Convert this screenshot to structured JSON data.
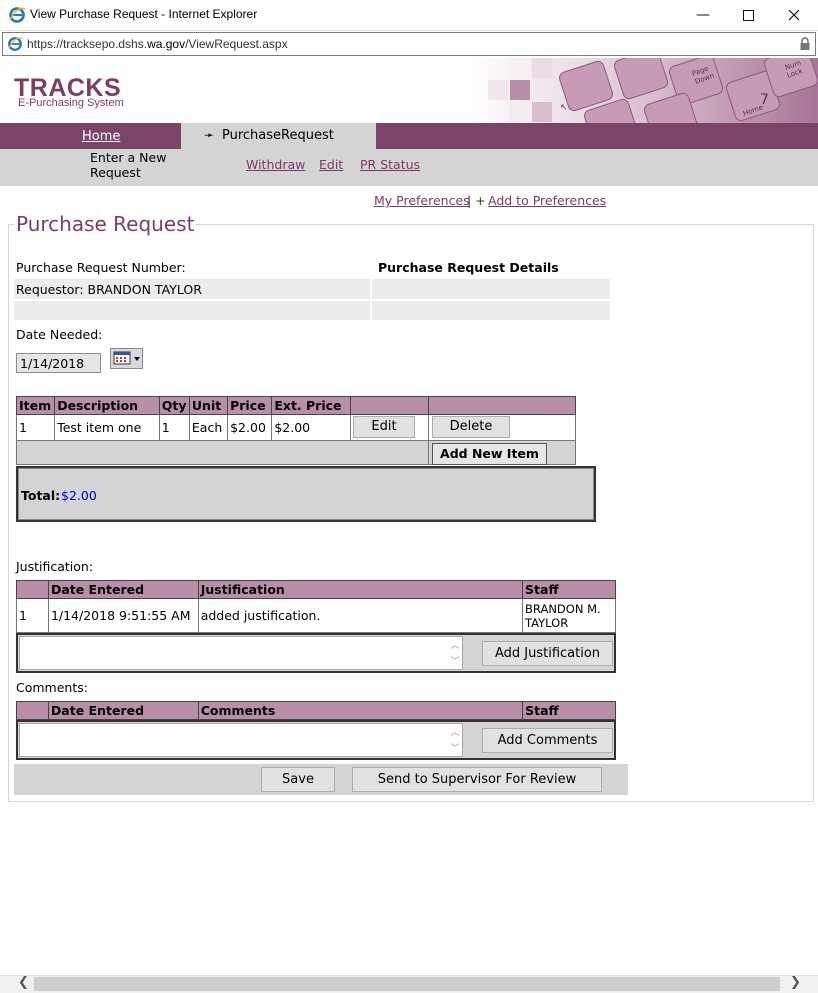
{
  "window": {
    "title": "View Purchase Request - Internet Explorer",
    "url_prefix": "https://tracksepo.dshs.",
    "url_domain": "wa.gov",
    "url_path": "/ViewRequest.aspx"
  },
  "header": {
    "logo": "TRACKS",
    "logo_sub": "E-Purchasing System"
  },
  "nav": {
    "home": "Home",
    "active_tab": "PurchaseRequest",
    "sub_enter_new": "Enter a New Request",
    "sub_withdraw": "Withdraw",
    "sub_edit": "Edit",
    "sub_pr_status": "PR Status"
  },
  "preferences": {
    "my_preferences": "My Preferences",
    "separator": "| +",
    "add_to_preferences": "Add to Preferences"
  },
  "page": {
    "title": "Purchase Request",
    "pr_number_label": "Purchase Request Number:",
    "pr_details_label": "Purchase Request Details",
    "requestor": "Requestor: BRANDON TAYLOR",
    "date_needed_label": "Date Needed:",
    "date_needed_value": "1/14/2018"
  },
  "items": {
    "headers": [
      "Item",
      "Description",
      "Qty",
      "Unit",
      "Price",
      "Ext. Price"
    ],
    "rows": [
      {
        "item": "1",
        "description": "Test item one",
        "qty": "1",
        "unit": "Each",
        "price": "$2.00",
        "ext_price": "$2.00"
      }
    ],
    "edit_label": "Edit",
    "delete_label": "Delete",
    "add_new_item_label": "Add New Item",
    "total_label": "Total:",
    "total_value": "$2.00"
  },
  "justification": {
    "label": "Justification:",
    "headers": [
      "",
      "Date Entered",
      "Justification",
      "Staff"
    ],
    "rows": [
      {
        "num": "1",
        "date": "1/14/2018 9:51:55 AM",
        "text": "added justification.",
        "staff": "BRANDON M. TAYLOR"
      }
    ],
    "add_button": "Add Justification"
  },
  "comments": {
    "label": "Comments:",
    "headers": [
      "",
      "Date Entered",
      "Comments",
      "Staff"
    ],
    "add_button": "Add Comments"
  },
  "actions": {
    "save": "Save",
    "send": "Send to Supervisor For Review"
  },
  "colors": {
    "brand": "#7d3c67",
    "nav_bar": "#7b4567",
    "table_header": "#b98ea9",
    "total_value": "#0000cc"
  }
}
